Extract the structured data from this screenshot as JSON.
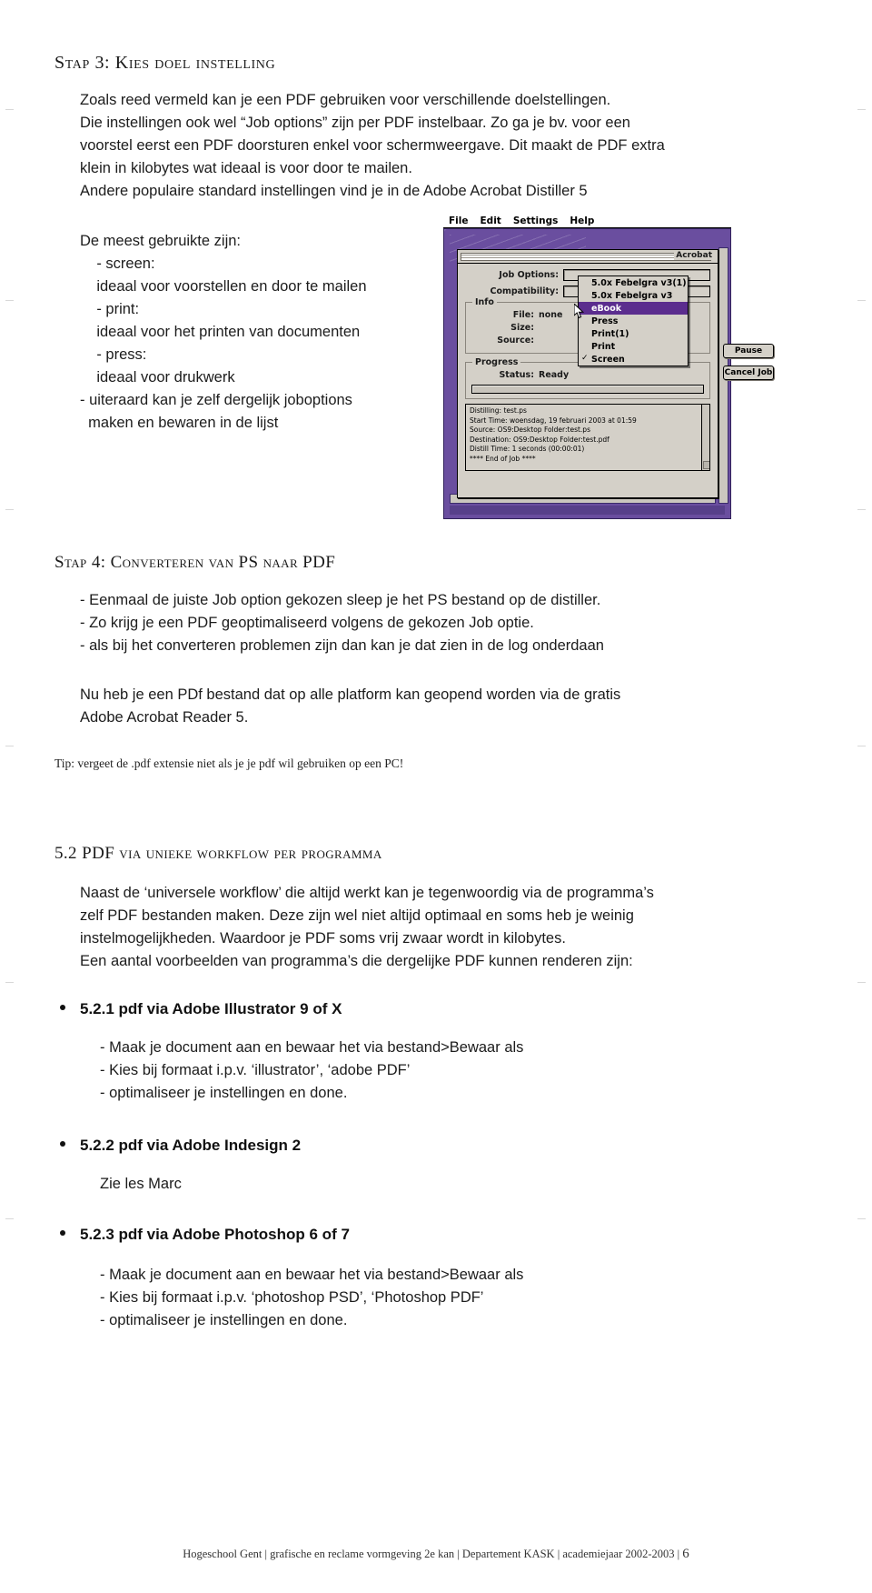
{
  "section_step3": {
    "heading": "Stap 3: Kies doel instelling",
    "paragraph_lines": [
      "Zoals reed vermeld kan je een PDF gebruiken voor verschillende doelstellingen.",
      "Die instellingen ook wel “Job options” zijn per PDF instelbaar. Zo ga je bv. voor een",
      "voorstel eerst een PDF doorsturen enkel voor schermweergave. Dit maakt de PDF extra",
      "klein in kilobytes wat ideaal is voor door te mailen.",
      "Andere populaire standard instellingen vind je in de Adobe Acrobat Distiller 5"
    ],
    "list_intro": "De meest gebruikte zijn:",
    "list_lines": [
      "    - screen:",
      "    ideaal voor voorstellen en door te mailen",
      "    - print:",
      "    ideaal voor het printen van documenten",
      "    - press:",
      "    ideaal voor drukwerk",
      "- uiteraard kan je zelf dergelijk joboptions",
      "  maken en bewaren in de lijst"
    ]
  },
  "screenshot": {
    "menubar": [
      "File",
      "Edit",
      "Settings",
      "Help"
    ],
    "window_title": "Acrobat",
    "fields": [
      {
        "label": "Job Options:",
        "value": ""
      },
      {
        "label": "Compatibility:",
        "value": ""
      }
    ],
    "info_group_title": "Info",
    "info_rows": [
      {
        "label": "File:",
        "value": "none"
      },
      {
        "label": "Size:",
        "value": ""
      },
      {
        "label": "Source:",
        "value": ""
      }
    ],
    "progress_group_title": "Progress",
    "status_label": "Status:",
    "status_value": "Ready",
    "buttons": [
      "Pause",
      "Cancel Job"
    ],
    "log_lines": [
      "Distilling: test.ps",
      "Start Time: woensdag, 19 februari 2003 at 01:59",
      "Source: OS9:Desktop Folder:test.ps",
      "Destination: OS9:Desktop Folder:test.pdf",
      "Distill Time: 1 seconds (00:00:01)",
      "**** End of Job ****"
    ],
    "dropdown_items": [
      {
        "label": "5.0x Febelgra v3(1)",
        "selected": false,
        "checked": false
      },
      {
        "label": "5.0x Febelgra v3",
        "selected": false,
        "checked": false
      },
      {
        "label": "eBook",
        "selected": true,
        "checked": false
      },
      {
        "label": "Press",
        "selected": false,
        "checked": false
      },
      {
        "label": "Print(1)",
        "selected": false,
        "checked": false
      },
      {
        "label": "Print",
        "selected": false,
        "checked": false
      },
      {
        "label": "Screen",
        "selected": false,
        "checked": true
      }
    ],
    "checkmark_glyph": "✓",
    "accent_color": "#5b2d8e",
    "desktop_color": "#6a4e9f",
    "chrome_color": "#d4d0c8"
  },
  "section_step4": {
    "heading": "Stap 4: Converteren van PS naar PDF",
    "bullet_lines": [
      "- Eenmaal de juiste Job option gekozen sleep je het PS bestand op de distiller.",
      "- Zo krijg je een PDF geoptimaliseerd volgens de gekozen Job optie.",
      "- als bij het converteren problemen zijn dan kan je dat zien in de log onderdaan"
    ],
    "closing_lines": [
      "Nu heb je een PDf bestand dat op alle platform kan geopend worden via de gratis",
      "Adobe Acrobat Reader 5."
    ],
    "tip": "Tip: vergeet de .pdf extensie niet als je je pdf wil gebruiken op een PC!"
  },
  "section_52": {
    "heading": "5.2 PDF via unieke workflow per programma",
    "paragraph_lines": [
      "Naast de ‘universele workflow’ die altijd werkt kan je tegenwoordig via de programma’s",
      "zelf PDF bestanden maken. Deze zijn wel niet altijd optimaal en soms heb je weinig",
      "instelmogelijkheden. Waardoor je PDF soms vrij zwaar wordt in kilobytes.",
      "Een aantal voorbeelden van programma’s die dergelijke PDF kunnen renderen zijn:"
    ],
    "bullets": [
      {
        "title": "5.2.1 pdf via Adobe Illustrator 9 of X",
        "lines": [
          "- Maak je document aan en bewaar het via bestand>Bewaar als",
          "- Kies bij formaat i.p.v. ‘illustrator’, ‘adobe PDF’",
          "- optimaliseer je instellingen en done."
        ]
      },
      {
        "title": "5.2.2 pdf via Adobe Indesign 2",
        "lines": [
          "Zie les Marc"
        ]
      },
      {
        "title": "5.2.3 pdf via Adobe Photoshop 6 of 7",
        "lines": [
          "- Maak je document aan en bewaar het via bestand>Bewaar als",
          "- Kies bij formaat i.p.v. ‘photoshop PSD’, ‘Photoshop PDF’",
          "- optimaliseer je instellingen en done."
        ]
      }
    ]
  },
  "footer": {
    "text": "Hogeschool Gent | grafische en reclame vormgeving 2e kan | Departement KASK | academiejaar 2002-2003 |",
    "page_number": "6"
  }
}
